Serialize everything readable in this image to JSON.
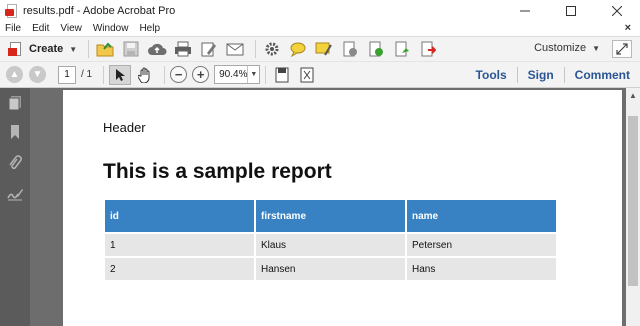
{
  "window": {
    "title": "results.pdf - Adobe Acrobat Pro",
    "controls": {
      "minimize": "—",
      "maximize": "☐",
      "close": "✕"
    }
  },
  "menu": {
    "items": [
      "File",
      "Edit",
      "View",
      "Window",
      "Help"
    ],
    "close_glyph": "×"
  },
  "toolbar": {
    "create_label": "Create",
    "customize_label": "Customize",
    "icons": [
      "open-folder-icon",
      "save-icon",
      "cloud-upload-icon",
      "print-icon",
      "edit-icon",
      "email-icon",
      "settings-icon",
      "comment-icon",
      "highlight-icon",
      "attach-icon",
      "export-icon",
      "sign-icon",
      "share-icon"
    ]
  },
  "navigation": {
    "page_current": "1",
    "page_total": "/ 1",
    "zoom": "90.4%",
    "links": [
      "Tools",
      "Sign",
      "Comment"
    ]
  },
  "document": {
    "header": "Header",
    "title": "This is a sample report",
    "columns": [
      "id",
      "firstname",
      "name"
    ],
    "rows": [
      [
        "1",
        "Klaus",
        "Petersen"
      ],
      [
        "2",
        "Hansen",
        "Hans"
      ]
    ]
  },
  "colors": {
    "table_header": "#3882c4",
    "table_row": "#e6e6e6",
    "link": "#2a5593",
    "acrobat_red": "#d7261b"
  }
}
